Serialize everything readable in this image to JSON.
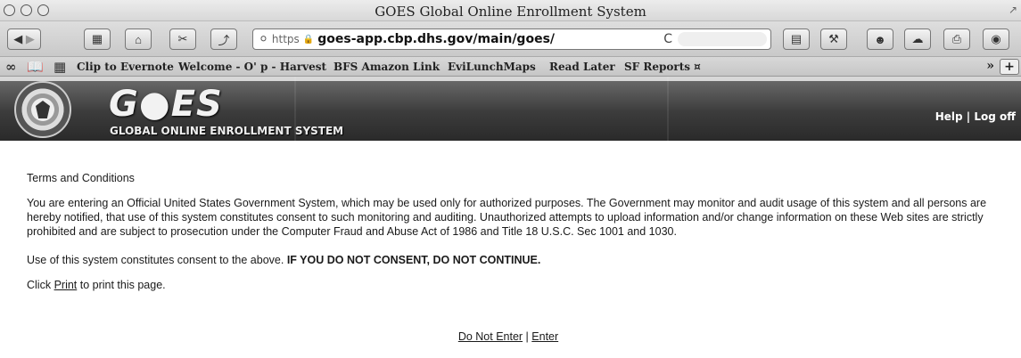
{
  "window": {
    "title": "GOES Global Online Enrollment System"
  },
  "toolbar": {
    "url_protocol": "https",
    "url": "goes-app.cbp.dhs.gov/main/goes/",
    "reload_glyph": "C"
  },
  "bookmarks": {
    "items": [
      "Clip to Evernote",
      "Welcome - O' p - Harvest",
      "BFS Amazon Link",
      "EviLunchMaps",
      "Read Later",
      "SF Reports ¤"
    ],
    "more_glyph": "»",
    "add_glyph": "+"
  },
  "banner": {
    "logo": "G●ES",
    "subtitle": "GLOBAL ONLINE ENROLLMENT SYSTEM",
    "help": "Help",
    "separator": " | ",
    "logoff": "Log off"
  },
  "content": {
    "heading": "Terms and Conditions",
    "paragraph": "You are entering an Official United States Government System, which may be used only for authorized purposes. The Government may monitor and audit usage of this system and all persons are hereby notified, that use of this system constitutes consent to such monitoring and auditing. Unauthorized attempts to upload information and/or change information on these Web sites are strictly prohibited and are subject to prosecution under the Computer Fraud and Abuse Act of 1986 and Title 18 U.S.C. Sec 1001 and 1030.",
    "consent_prefix": "Use of this system constitutes consent to the above. ",
    "consent_warning": "IF YOU DO NOT CONSENT, DO NOT CONTINUE.",
    "print_prefix": "Click ",
    "print_link": "Print",
    "print_suffix": " to print this page.",
    "do_not_enter": "Do Not Enter",
    "link_separator": " | ",
    "enter": "Enter"
  }
}
